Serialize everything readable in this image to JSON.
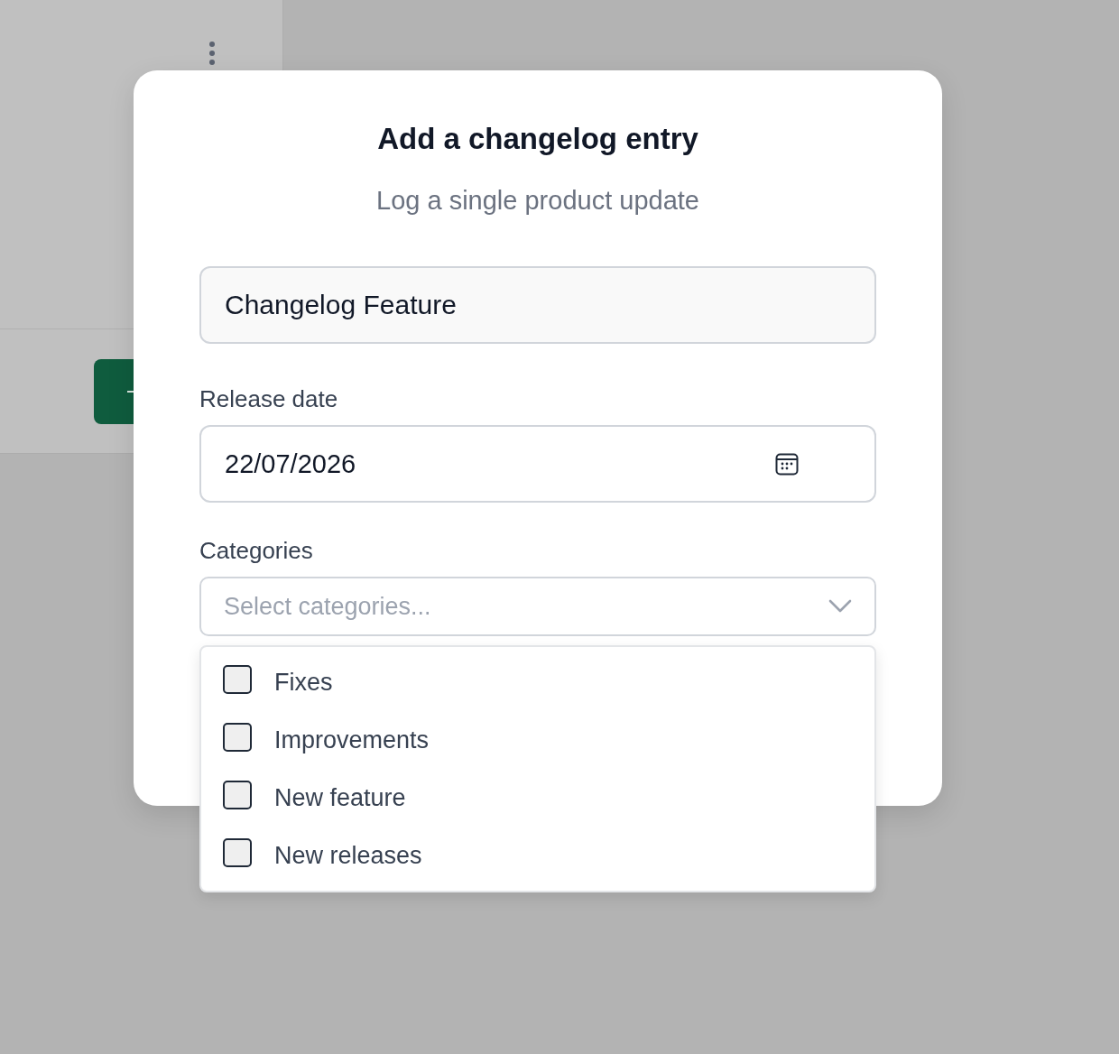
{
  "dialog": {
    "title": "Add a changelog entry",
    "subtitle": "Log a single product update",
    "name_field": {
      "value": "Changelog Feature"
    },
    "release_date": {
      "label": "Release date",
      "value": "22/07/2026"
    },
    "categories": {
      "label": "Categories",
      "placeholder": "Select categories...",
      "expanded": true,
      "options": [
        {
          "label": "Fixes",
          "checked": false
        },
        {
          "label": "Improvements",
          "checked": false
        },
        {
          "label": "New feature",
          "checked": false
        },
        {
          "label": "New releases",
          "checked": false
        }
      ]
    }
  }
}
